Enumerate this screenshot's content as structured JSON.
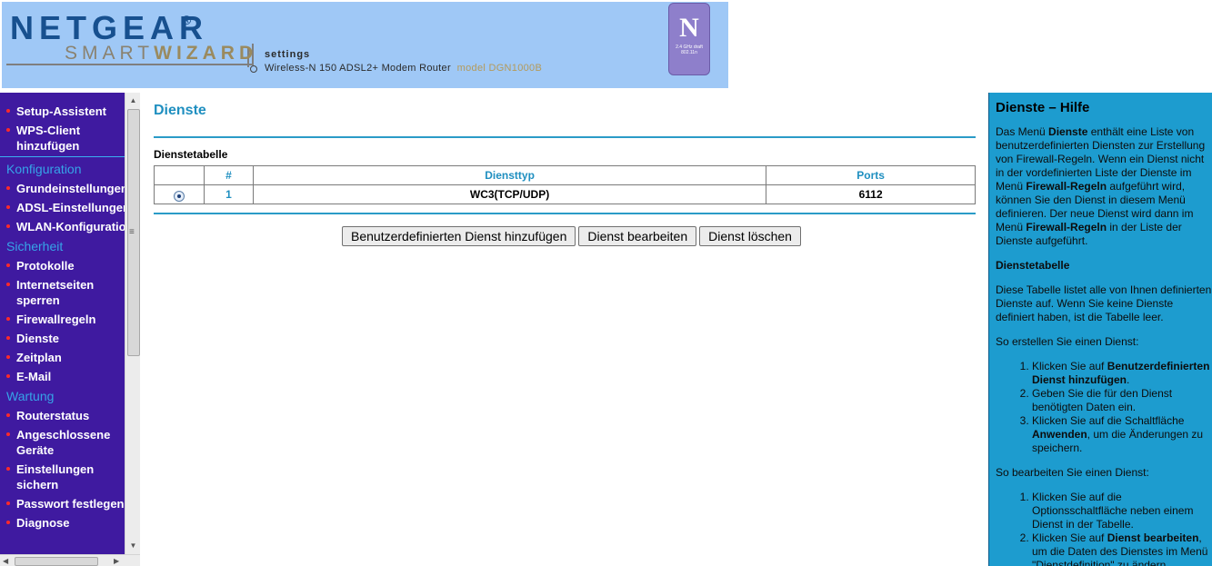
{
  "header": {
    "brand": "NETGEAR",
    "brand_mark": "®",
    "subbrand_light": "SMART",
    "subbrand_bold": "WIZARD",
    "settings": "settings",
    "product": "Wireless-N 150 ADSL2+ Modem Router",
    "model": "model DGN1000B",
    "badge_letter": "N",
    "badge_caption": "2.4 GHz draft 802.11n"
  },
  "nav": {
    "items": [
      {
        "type": "item",
        "label": "Setup-Assistent"
      },
      {
        "type": "item",
        "label": "WPS-Client hinzufügen"
      },
      {
        "type": "section",
        "label": "Konfiguration"
      },
      {
        "type": "item",
        "label": "Grundeinstellungen"
      },
      {
        "type": "item",
        "label": "ADSL-Einstellungen"
      },
      {
        "type": "item",
        "label": "WLAN-Konfiguration"
      },
      {
        "type": "section",
        "label": "Sicherheit"
      },
      {
        "type": "item",
        "label": "Protokolle"
      },
      {
        "type": "item",
        "label": "Internetseiten sperren"
      },
      {
        "type": "item",
        "label": "Firewallregeln"
      },
      {
        "type": "item",
        "label": "Dienste"
      },
      {
        "type": "item",
        "label": "Zeitplan"
      },
      {
        "type": "item",
        "label": "E-Mail"
      },
      {
        "type": "section",
        "label": "Wartung"
      },
      {
        "type": "item",
        "label": "Routerstatus"
      },
      {
        "type": "item",
        "label": "Angeschlossene Geräte"
      },
      {
        "type": "item",
        "label": "Einstellungen sichern"
      },
      {
        "type": "item",
        "label": "Passwort festlegen"
      },
      {
        "type": "item",
        "label": "Diagnose"
      }
    ]
  },
  "main": {
    "title": "Dienste",
    "table_title": "Dienstetabelle",
    "columns": [
      "",
      "#",
      "Diensttyp",
      "Ports"
    ],
    "rows": [
      {
        "selected": true,
        "index": "1",
        "type": "WC3(TCP/UDP)",
        "ports": "6112"
      }
    ],
    "buttons": {
      "add": "Benutzerdefinierten Dienst hinzufügen",
      "edit": "Dienst bearbeiten",
      "delete": "Dienst löschen"
    }
  },
  "help": {
    "title": "Dienste – Hilfe",
    "intro_1": "Das Menü ",
    "intro_b1": "Dienste",
    "intro_2": " enthält eine Liste von benutzerdefinierten Diensten zur Erstellung von Firewall-Regeln. Wenn ein Dienst nicht in der vordefinierten Liste der Dienste im Menü ",
    "intro_b2": "Firewall-Regeln",
    "intro_3": " aufgeführt wird, können Sie den Dienst in diesem Menü definieren. Der neue Dienst wird dann im Menü ",
    "intro_b3": "Firewall-Regeln",
    "intro_4": " in der Liste der Dienste aufgeführt.",
    "table_heading": "Dienstetabelle",
    "table_text": "Diese Tabelle listet alle von Ihnen definierten Dienste auf. Wenn Sie keine Dienste definiert haben, ist die Tabelle leer.",
    "create_heading": "So erstellen Sie einen Dienst:",
    "create_steps": [
      {
        "pre": "Klicken Sie auf ",
        "bold": "Benutzerdefinierten Dienst hinzufügen",
        "post": "."
      },
      {
        "pre": "Geben Sie die für den Dienst benötigten Daten ein.",
        "bold": "",
        "post": ""
      },
      {
        "pre": "Klicken Sie auf die Schaltfläche ",
        "bold": "Anwenden",
        "post": ", um die Änderungen zu speichern."
      }
    ],
    "edit_heading": "So bearbeiten Sie einen Dienst:",
    "edit_steps": [
      {
        "pre": "Klicken Sie auf die Optionsschaltfläche neben einem Dienst in der Tabelle.",
        "bold": "",
        "post": ""
      },
      {
        "pre": "Klicken Sie auf ",
        "bold": "Dienst bearbeiten",
        "post": ", um die Daten des Dienstes im Menü \"Dienstdefinition\" zu ändern."
      }
    ]
  }
}
